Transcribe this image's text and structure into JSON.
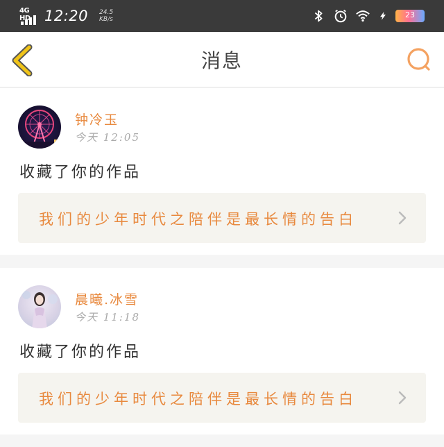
{
  "status_bar": {
    "network": "4G HD",
    "time": "12:20",
    "speed_value": "24.5",
    "speed_unit": "KB/s",
    "battery_level": "23",
    "icons": [
      "signal-icon",
      "bluetooth-icon",
      "alarm-icon",
      "wifi-icon",
      "charging-icon",
      "battery-icon"
    ]
  },
  "header": {
    "title": "消息",
    "back_icon": "chevron-left-icon",
    "search_icon": "search-icon",
    "accent_color": "#f0c419",
    "search_color": "#f4a261"
  },
  "messages": [
    {
      "username": "钟冷玉",
      "time": "今天 12:05",
      "action": "收藏了你的作品",
      "work_title": "我们的少年时代之陪伴是最长情的告白"
    },
    {
      "username": "晨曦.冰雪",
      "time": "今天 11:18",
      "action": "收藏了你的作品",
      "work_title": "我们的少年时代之陪伴是最长情的告白"
    }
  ],
  "colors": {
    "username": "#e8893e",
    "work_title": "#e8893e",
    "link_bg": "#f5f4ef",
    "divider_bg": "#f5f5f5"
  }
}
